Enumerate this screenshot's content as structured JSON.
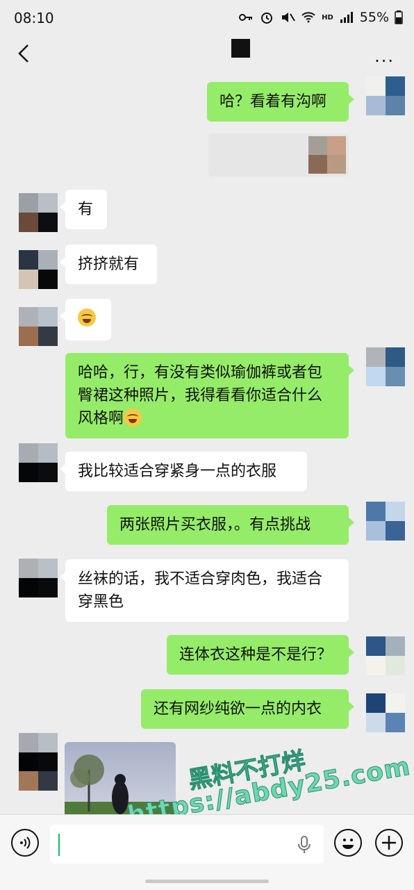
{
  "status_bar": {
    "time": "08:10",
    "battery": "55%",
    "network": "HD"
  },
  "header": {
    "more_label": "···"
  },
  "messages": [
    {
      "side": "out",
      "text": "哈？看着有沟啊"
    },
    {
      "side": "in",
      "text": "有"
    },
    {
      "side": "in",
      "text": "挤挤就有"
    },
    {
      "side": "out",
      "text": "哈哈，行，有没有类似瑜伽裤或者包臀裙这种照片，我得看看你适合什么风格啊"
    },
    {
      "side": "in",
      "text": "我比较适合穿紧身一点的衣服"
    },
    {
      "side": "out",
      "text": "两张照片买衣服，。有点挑战"
    },
    {
      "side": "in",
      "text": "丝袜的话，我不适合穿肉色，我适合穿黑色"
    },
    {
      "side": "out",
      "text": "连体衣这种是不是行？"
    },
    {
      "side": "out",
      "text": "还有网纱纯欲一点的内衣"
    }
  ],
  "watermark": {
    "line1": "黑料不打烊",
    "line2": "https://abdy25.com"
  },
  "icons": {
    "back": "chevron-left-icon",
    "more": "more-icon",
    "voice": "voice-icon",
    "mic": "mic-icon",
    "emoji": "emoji-icon",
    "plus": "plus-icon"
  },
  "colors": {
    "bubble_out": "#95ec69",
    "bubble_in": "#ffffff",
    "background": "#ededed",
    "accent": "#07c160"
  }
}
